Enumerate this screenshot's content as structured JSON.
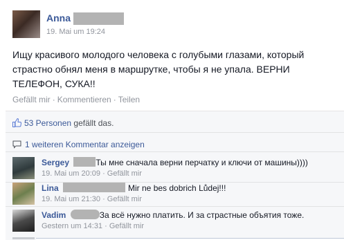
{
  "post": {
    "author": "Anna",
    "timestamp": "19. Mai um 19:24",
    "text": "Ищу красивого молодого человека с голубыми глазами, который страстно обнял меня в маршрутке, чтобы я не упала. ВЕРНИ ТЕЛЕФОН, СУКА!!",
    "actions": [
      "Gefällt mir",
      "Kommentieren",
      "Teilen"
    ],
    "separator": "·"
  },
  "likes": {
    "count_text": "53 Personen",
    "suffix": "gefällt das."
  },
  "more_comments": "1 weiteren Kommentar anzeigen",
  "comments": [
    {
      "name": "Sergey",
      "text": "Ты мне сначала верни перчатку и ключи от машины))))",
      "time": "19. Mai um 20:09",
      "action": "Gefällt mir"
    },
    {
      "name": "Lina",
      "text": "Mir ne bes dobrich Lůdej!!!",
      "time": "19. Mai um 21:30",
      "action": "Gefällt mir"
    },
    {
      "name": "Vadim",
      "text": "За всё нужно платить. И за страстные объятия тоже.",
      "time": "Gestern um 14:31",
      "action": "Gefällt mir"
    }
  ],
  "colors": {
    "link": "#3b5998",
    "meta": "#90949c",
    "feedback_bg": "#f6f7f9"
  }
}
